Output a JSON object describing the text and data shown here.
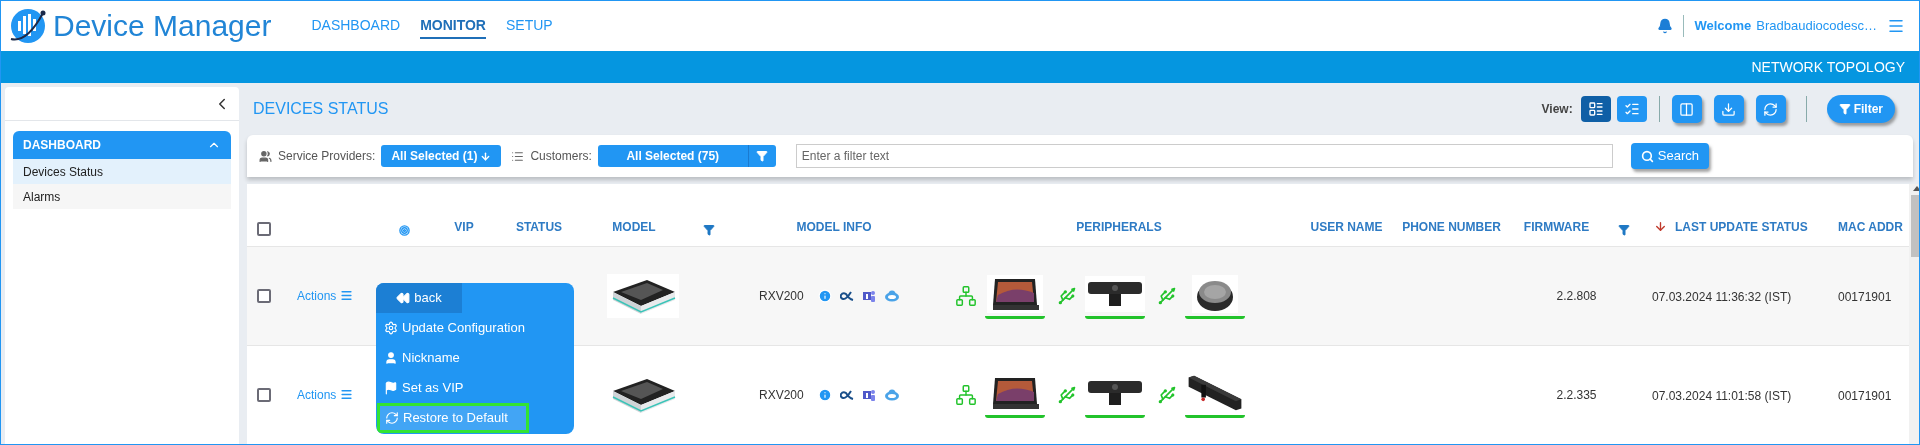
{
  "header": {
    "app_title": "Device Manager",
    "nav": [
      {
        "label": "DASHBOARD",
        "selected": false
      },
      {
        "label": "MONITOR",
        "selected": true
      },
      {
        "label": "SETUP",
        "selected": false
      }
    ],
    "welcome_label": "Welcome",
    "user_name": "Bradbaudiocodesc…"
  },
  "topology_link": "NETWORK TOPOLOGY",
  "sidebar": {
    "section": {
      "label": "DASHBOARD",
      "expanded": true,
      "items": [
        {
          "label": "Devices Status",
          "selected": true
        },
        {
          "label": "Alarms",
          "selected": false
        }
      ]
    }
  },
  "page_title": "DEVICES STATUS",
  "view": {
    "label": "View:",
    "modes": [
      {
        "selected": true
      },
      {
        "selected": false
      }
    ]
  },
  "filter_button": "Filter",
  "filters": {
    "service_providers_label": "Service Providers:",
    "service_providers_value": "All Selected (1)",
    "customers_label": "Customers:",
    "customers_value": "All Selected (75)",
    "placeholder": "Enter a filter text",
    "search_button": "Search"
  },
  "table": {
    "columns": [
      {
        "kind": "checkbox",
        "checked": false
      },
      {
        "kind": "target"
      },
      {
        "kind": "text",
        "label": "VIP"
      },
      {
        "kind": "text",
        "label": "STATUS"
      },
      {
        "kind": "text",
        "label": "MODEL"
      },
      {
        "kind": "filter"
      },
      {
        "kind": "text",
        "label": "MODEL INFO"
      },
      {
        "kind": "text",
        "label": "PERIPHERALS"
      },
      {
        "kind": "text",
        "label": "USER NAME"
      },
      {
        "kind": "text",
        "label": "PHONE NUMBER"
      },
      {
        "kind": "text",
        "label": "FIRMWARE"
      },
      {
        "kind": "filter"
      },
      {
        "kind": "sort",
        "label": "LAST UPDATE STATUS"
      },
      {
        "kind": "text",
        "label": "MAC ADDR"
      }
    ],
    "rows": [
      {
        "checked": false,
        "actions": "Actions",
        "model": "RXV200",
        "firmware": "2.2.808",
        "last_update": "07.03.2024 11:36:32 (IST)",
        "mac": "00171901",
        "peripherals": [
          {
            "kind": "network"
          },
          {
            "kind": "usb"
          },
          {
            "kind": "usb"
          }
        ]
      },
      {
        "checked": false,
        "actions": "Actions",
        "model": "RXV200",
        "firmware": "2.2.335",
        "last_update": "07.03.2024 11:01:58 (IST)",
        "mac": "00171901",
        "peripherals": [
          {
            "kind": "network"
          },
          {
            "kind": "usb"
          },
          {
            "kind": "usb"
          }
        ]
      }
    ]
  },
  "actions_menu": {
    "items": [
      {
        "kind": "back",
        "label": "back",
        "selected": false
      },
      {
        "kind": "gear",
        "label": "Update Configuration",
        "selected": false
      },
      {
        "kind": "user",
        "label": "Nickname",
        "selected": false
      },
      {
        "kind": "flag",
        "label": "Set as VIP",
        "selected": false
      },
      {
        "kind": "refresh",
        "label": "Restore to Default",
        "selected": true
      }
    ]
  }
}
